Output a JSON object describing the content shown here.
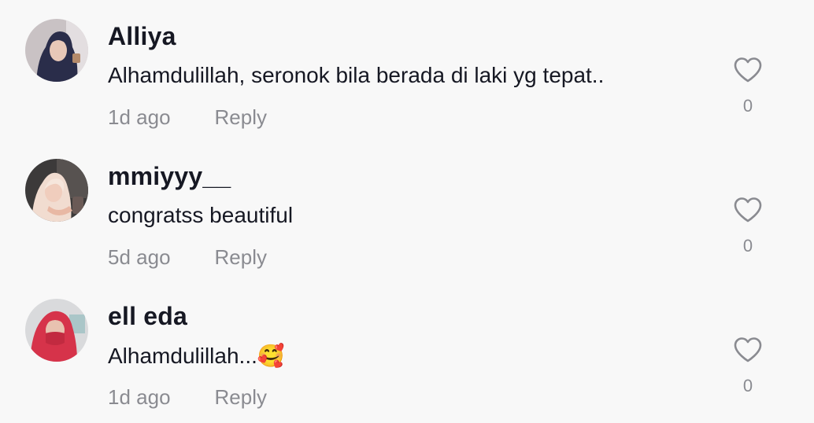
{
  "comments": [
    {
      "username": "Alliya",
      "text": "Alhamdulillah, seronok bila berada di laki yg tepat..",
      "time": "1d ago",
      "reply_label": "Reply",
      "likes": "0"
    },
    {
      "username": "mmiyyy__",
      "text": "congratss beautiful",
      "time": "5d ago",
      "reply_label": "Reply",
      "likes": "0"
    },
    {
      "username": "ell eda",
      "text": "Alhamdulillah...🥰",
      "time": "1d ago",
      "reply_label": "Reply",
      "likes": "0"
    }
  ],
  "icons": {
    "like": "heart-outline-icon"
  },
  "colors": {
    "text_primary": "#161823",
    "text_secondary": "#8a8b91",
    "background": "#f8f8f8"
  }
}
